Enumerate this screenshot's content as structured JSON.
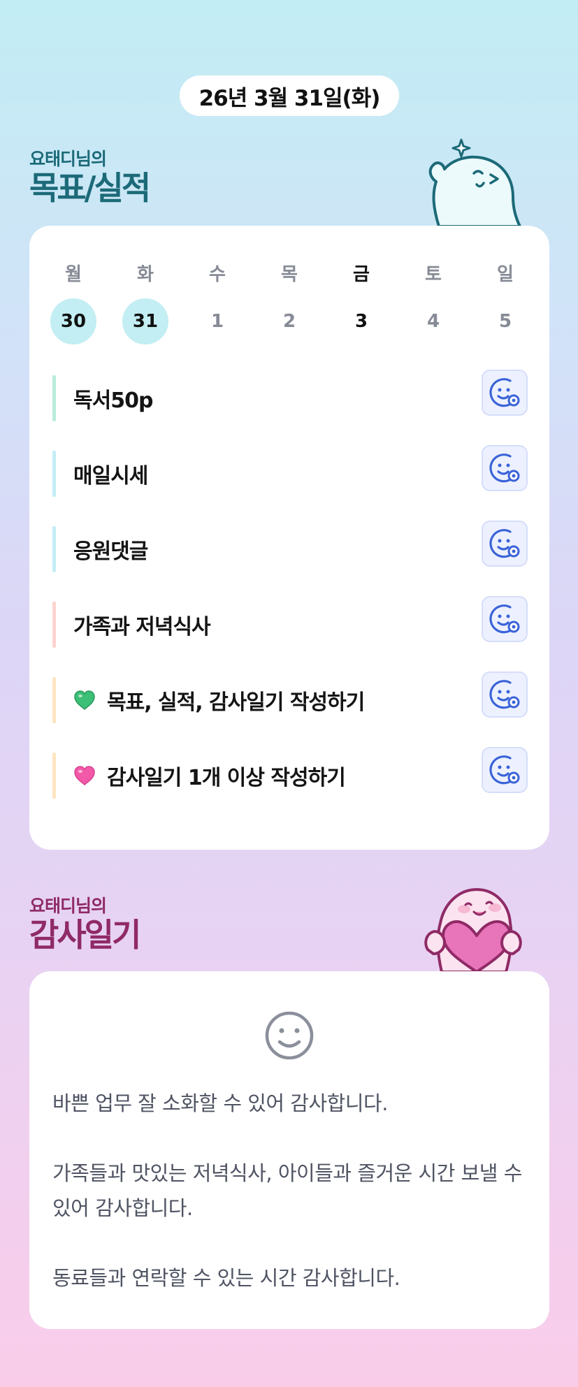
{
  "header": {
    "date": "26년 3월 31일(화)"
  },
  "goals_section": {
    "owner_label": "요태디님의",
    "title": "목표/실적",
    "week": [
      {
        "day": "월",
        "date": "30",
        "state": "past"
      },
      {
        "day": "화",
        "date": "31",
        "state": "past"
      },
      {
        "day": "수",
        "date": "1",
        "state": "future"
      },
      {
        "day": "목",
        "date": "2",
        "state": "future"
      },
      {
        "day": "금",
        "date": "3",
        "state": "today"
      },
      {
        "day": "토",
        "date": "4",
        "state": "future"
      },
      {
        "day": "일",
        "date": "5",
        "state": "future"
      }
    ],
    "goals": [
      {
        "text": "독서50p",
        "bar_color": "#b9ecd9",
        "emoji": ""
      },
      {
        "text": "매일시세",
        "bar_color": "#c4eef5",
        "emoji": ""
      },
      {
        "text": "응원댓글",
        "bar_color": "#c4eef5",
        "emoji": ""
      },
      {
        "text": "가족과 저녁식사",
        "bar_color": "#fcd3d0",
        "emoji": ""
      },
      {
        "text": "목표, 실적, 감사일기 작성하기",
        "bar_color": "#fde5c2",
        "emoji": "green-heart-icon"
      },
      {
        "text": "감사일기 1개 이상 작성하기",
        "bar_color": "#fde5c2",
        "emoji": "pink-heart-icon"
      }
    ],
    "check_icon": "smiley-add-icon"
  },
  "gratitude_section": {
    "owner_label": "요태디님의",
    "title": "감사일기",
    "mood_icon": "smiley-face-icon",
    "entries": [
      "바쁜 업무 잘 소화할 수 있어 감사합니다.",
      "가족들과 맛있는 저녁식사, 아이들과 즐거운 시간 보낼 수 있어 감사합니다.",
      "동료들과 연락할 수 있는 시간 감사합니다."
    ]
  },
  "colors": {
    "goal_title": "#1c6a78",
    "gratitude_title": "#8f2a66",
    "past_day_circle": "#c3eef3",
    "check_button_bg": "#edf1ff",
    "check_icon": "#3a63d8"
  }
}
